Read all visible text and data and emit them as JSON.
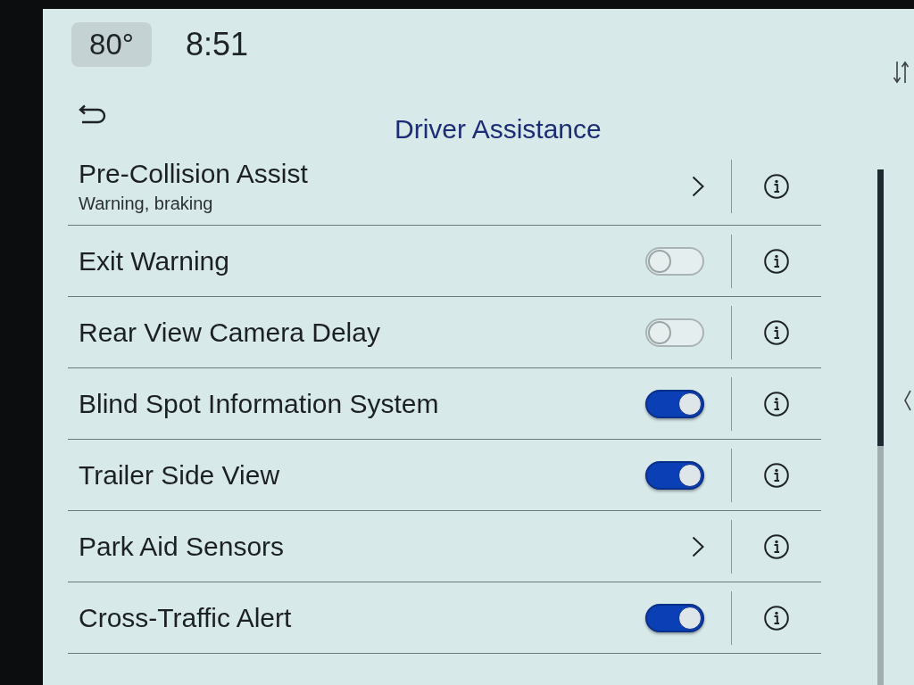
{
  "status_bar": {
    "temperature": "80°",
    "time": "8:51"
  },
  "header": {
    "title": "Driver Assistance"
  },
  "settings": [
    {
      "kind": "submenu",
      "label": "Pre-Collision Assist",
      "subtitle": "Warning, braking"
    },
    {
      "kind": "toggle",
      "label": "Exit Warning",
      "on": false
    },
    {
      "kind": "toggle",
      "label": "Rear View Camera Delay",
      "on": false
    },
    {
      "kind": "toggle",
      "label": "Blind Spot Information System",
      "on": true
    },
    {
      "kind": "toggle",
      "label": "Trailer Side View",
      "on": true
    },
    {
      "kind": "submenu",
      "label": "Park Aid Sensors"
    },
    {
      "kind": "toggle",
      "label": "Cross-Traffic Alert",
      "on": true
    }
  ]
}
